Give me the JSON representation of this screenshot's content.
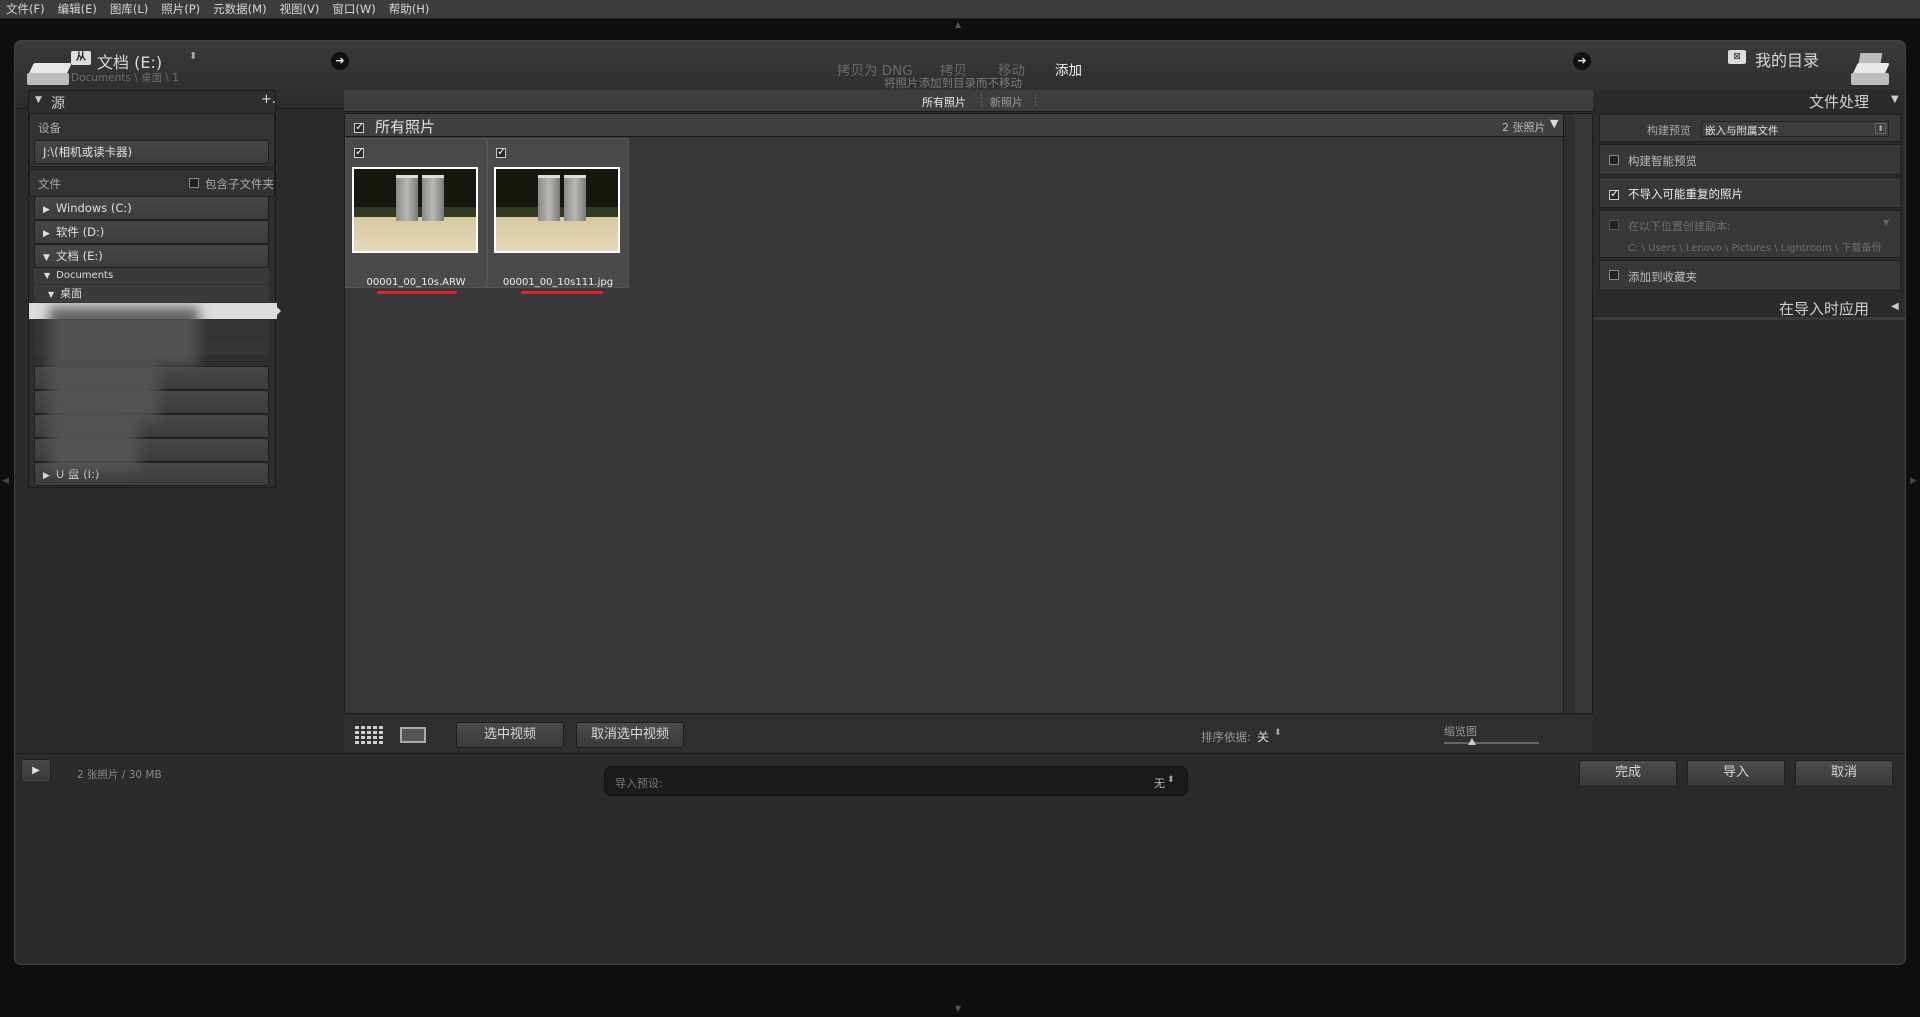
{
  "menu": [
    "文件(F)",
    "编辑(E)",
    "图库(L)",
    "照片(P)",
    "元数据(M)",
    "视图(V)",
    "窗口(W)",
    "帮助(H)"
  ],
  "source_header": {
    "title": "文档 (E:)",
    "path": "Documents \\ 桌面 \\ 1"
  },
  "modes": {
    "copy_dng": "拷贝为 DNG",
    "copy": "拷贝",
    "move": "移动",
    "add": "添加",
    "subtitle": "将照片添加到目录而不移动"
  },
  "destination_header": {
    "title": "我的目录"
  },
  "source_panel": {
    "title": "源",
    "plus": "+.",
    "devices_label": "设备",
    "device": "J:\\(相机或读卡器)",
    "files_label": "文件",
    "include_subfolders": "包含子文件夹",
    "drives": [
      "Windows (C:)",
      "软件 (D:)",
      "文档 (E:)"
    ],
    "folder_documents": "Documents",
    "folder_desktop": "桌面",
    "drive_last": "U 盘 (I:)"
  },
  "grid": {
    "tab_all": "所有照片",
    "tab_new": "新照片",
    "header_title": "所有照片",
    "count": "2 张照片",
    "photos": [
      {
        "name": "00001_00_10s.ARW",
        "checked": true
      },
      {
        "name": "00001_00_10s111.jpg",
        "checked": true
      }
    ]
  },
  "toolbar": {
    "check_all": "选中视频",
    "uncheck_all": "取消选中视频",
    "sort_label": "排序依据:",
    "sort_value": "关",
    "thumbnail_label": "缩览图"
  },
  "file_handling": {
    "title": "文件处理",
    "build_preview_label": "构建预览",
    "build_preview_value": "嵌入与附属文件",
    "smart_preview": "构建智能预览",
    "dont_import_dupes": "不导入可能重复的照片",
    "make_second_copy": "在以下位置创建副本:",
    "second_copy_path": "C: \\ Users \\ Lenovo \\ Pictures \\ Lightroom \\ 下载备份",
    "add_to_collection": "添加到收藏夹",
    "apply_during_import": "在导入时应用"
  },
  "footer": {
    "summary": "2 张照片 / 30 MB",
    "preset_label": "导入预设:",
    "preset_value": "无",
    "done": "完成",
    "import": "导入",
    "cancel": "取消"
  }
}
